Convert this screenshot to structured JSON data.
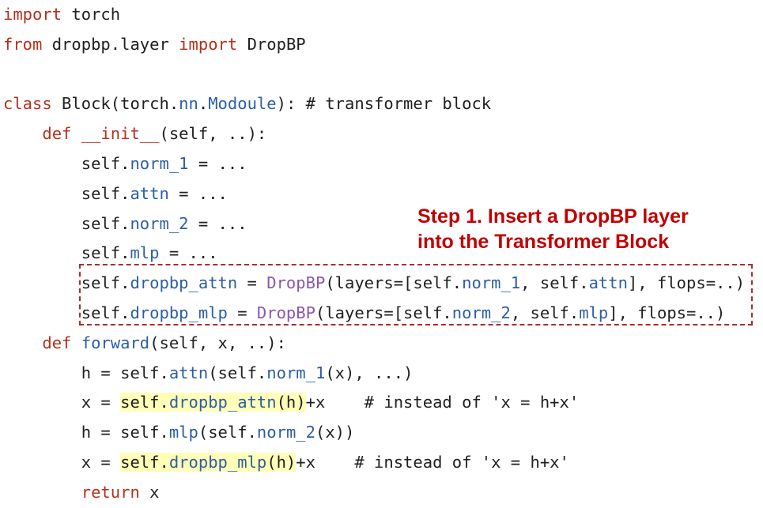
{
  "code_lines": [
    [
      {
        "t": "import",
        "c": "kw"
      },
      {
        "t": " torch"
      }
    ],
    [
      {
        "t": "from",
        "c": "kw"
      },
      {
        "t": " dropbp.layer "
      },
      {
        "t": "import",
        "c": "kw"
      },
      {
        "t": " DropBP"
      }
    ],
    [],
    [
      {
        "t": "class",
        "c": "kw"
      },
      {
        "t": " Block(torch."
      },
      {
        "t": "nn",
        "c": "at"
      },
      {
        "t": "."
      },
      {
        "t": "Modoule",
        "c": "at"
      },
      {
        "t": "): # transformer block"
      }
    ],
    [
      {
        "t": "    "
      },
      {
        "t": "def",
        "c": "kw"
      },
      {
        "t": " "
      },
      {
        "t": "__init__",
        "c": "kw"
      },
      {
        "t": "(self, ..):"
      }
    ],
    [
      {
        "t": "        self."
      },
      {
        "t": "norm_1",
        "c": "at"
      },
      {
        "t": " = ..."
      }
    ],
    [
      {
        "t": "        self."
      },
      {
        "t": "attn",
        "c": "at"
      },
      {
        "t": " = ..."
      }
    ],
    [
      {
        "t": "        self."
      },
      {
        "t": "norm_2",
        "c": "at"
      },
      {
        "t": " = ..."
      }
    ],
    [
      {
        "t": "        self."
      },
      {
        "t": "mlp",
        "c": "at"
      },
      {
        "t": " = ..."
      }
    ],
    [
      {
        "t": "        self."
      },
      {
        "t": "dropbp_attn",
        "c": "at"
      },
      {
        "t": " = "
      },
      {
        "t": "DropBP",
        "c": "cl"
      },
      {
        "t": "(layers=[self."
      },
      {
        "t": "norm_1",
        "c": "at"
      },
      {
        "t": ", self."
      },
      {
        "t": "attn",
        "c": "at"
      },
      {
        "t": "], flops=..)"
      }
    ],
    [
      {
        "t": "        self."
      },
      {
        "t": "dropbp_mlp",
        "c": "at"
      },
      {
        "t": " = "
      },
      {
        "t": "DropBP",
        "c": "cl"
      },
      {
        "t": "(layers=[self."
      },
      {
        "t": "norm_2",
        "c": "at"
      },
      {
        "t": ", self."
      },
      {
        "t": "mlp",
        "c": "at"
      },
      {
        "t": "], flops=..)"
      }
    ],
    [
      {
        "t": "    "
      },
      {
        "t": "def",
        "c": "kw"
      },
      {
        "t": " "
      },
      {
        "t": "forward",
        "c": "at"
      },
      {
        "t": "(self, x, ..):"
      }
    ],
    [
      {
        "t": "        h = self."
      },
      {
        "t": "attn",
        "c": "at"
      },
      {
        "t": "(self."
      },
      {
        "t": "norm_1",
        "c": "at"
      },
      {
        "t": "(x), ...)"
      }
    ],
    [
      {
        "t": "        x = "
      },
      {
        "t": "self.",
        "h": true
      },
      {
        "t": "dropbp_attn",
        "c": "at",
        "h": true
      },
      {
        "t": "(h)",
        "h": true
      },
      {
        "t": "+x    # instead of 'x = h+x'"
      }
    ],
    [
      {
        "t": "        h = self."
      },
      {
        "t": "mlp",
        "c": "at"
      },
      {
        "t": "(self."
      },
      {
        "t": "norm_2",
        "c": "at"
      },
      {
        "t": "(x))"
      }
    ],
    [
      {
        "t": "        x = "
      },
      {
        "t": "self.",
        "h": true
      },
      {
        "t": "dropbp_mlp",
        "c": "at",
        "h": true
      },
      {
        "t": "(h)",
        "h": true
      },
      {
        "t": "+x    # instead of 'x = h+x'"
      }
    ],
    [
      {
        "t": "        "
      },
      {
        "t": "return",
        "c": "kw"
      },
      {
        "t": " x"
      }
    ]
  ],
  "annotation": {
    "line1": "Step 1. Insert a DropBP layer",
    "line2": "into the Transformer Block"
  },
  "colors": {
    "keyword": "#b5301c",
    "attribute": "#2c5ea6",
    "class_name": "#8a55b5",
    "highlight": "#ffffb8",
    "annotation": "#c00000"
  }
}
